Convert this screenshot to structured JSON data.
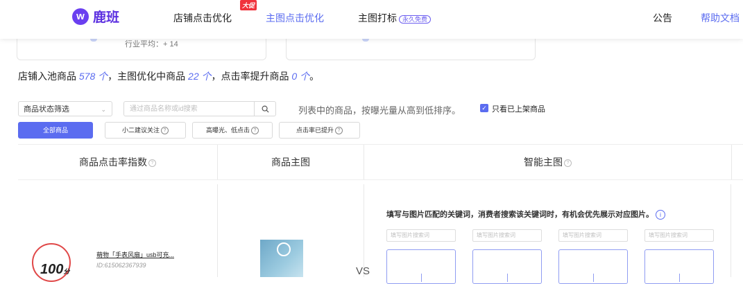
{
  "nav": {
    "brand": "鹿班",
    "brand_mark": "w",
    "items": [
      {
        "label": "店铺点击优化"
      },
      {
        "label": "主图点击优化"
      },
      {
        "label": "主图打标"
      },
      {
        "label": "公告"
      },
      {
        "label": "帮助文档"
      }
    ],
    "hot_badge": "大促",
    "free_badge": "永久免费"
  },
  "stats": {
    "industry_avg": "行业平均：+ 14"
  },
  "summary": {
    "p1": "店铺入池商品 ",
    "n1": "578 个",
    "p2": "，主图优化中商品 ",
    "n2": "22 个",
    "p3": "，点击率提升商品 ",
    "n3": "0 个",
    "p4": "。"
  },
  "filters": {
    "status_select": "商品状态筛选",
    "search_placeholder": "通过商品名称或id搜索",
    "hint": "列表中的商品，按曝光量从高到低排序。",
    "only_listed_label": "只看已上架商品",
    "only_listed_checked": true,
    "tabs": [
      {
        "label": "全部商品",
        "active": true
      },
      {
        "label": "小二建议关注"
      },
      {
        "label": "高曝光、低点击"
      },
      {
        "label": "点击率已提升"
      }
    ]
  },
  "table": {
    "headers": [
      "商品点击率指数",
      "商品主图",
      "智能主图"
    ],
    "row": {
      "score": "100",
      "score_unit": "分",
      "title": "萌物「手表风扇」usb可充...",
      "id": "ID:615062367939",
      "vs": "VS",
      "smart_title": "填写与图片匹配的关键词，消费者搜索该关键词时，有机会优先展示对应图片。",
      "kw_placeholder": "填写图片搜索词"
    }
  },
  "colors": {
    "accent": "#5b6cf0",
    "brand": "#5b2fe0",
    "score_ring": "#e04848",
    "hot": "#f0323c"
  }
}
